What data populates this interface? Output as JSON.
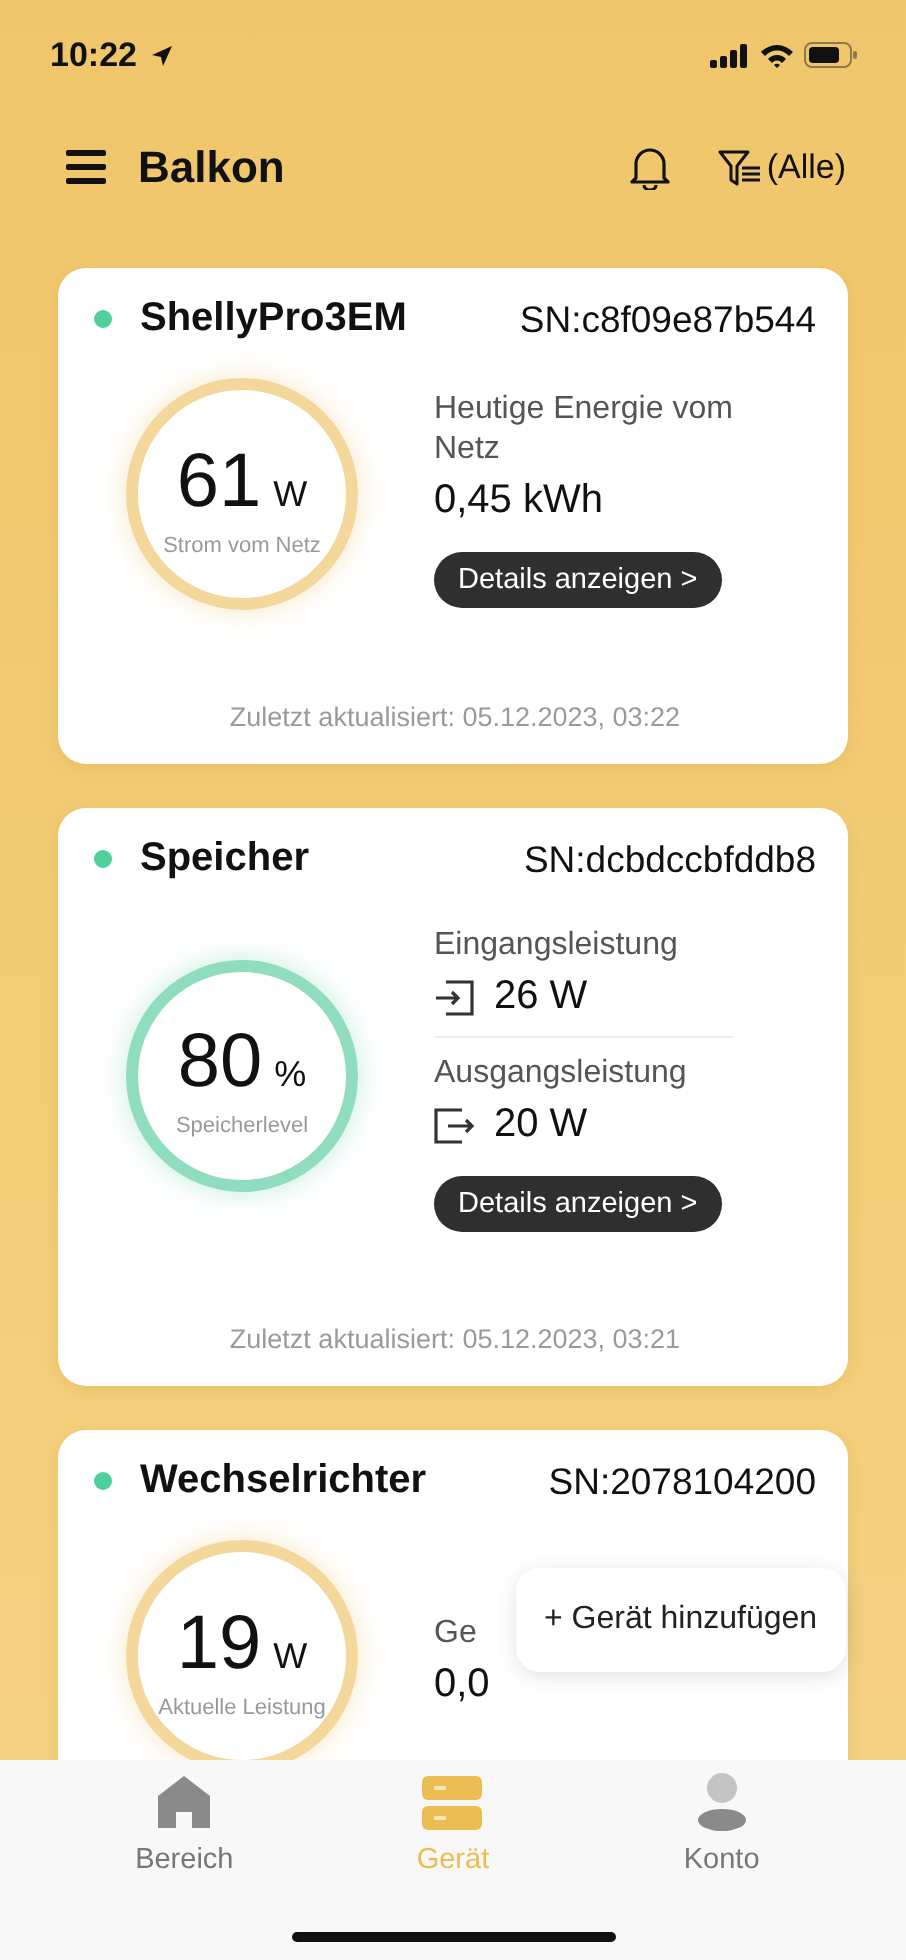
{
  "status_bar": {
    "time": "10:22"
  },
  "header": {
    "title": "Balkon",
    "filter": "(Alle)"
  },
  "cards": [
    {
      "kind": "meter",
      "name": "ShellyPro3EM",
      "online": true,
      "sn": "SN:c8f09e87b544",
      "value": "61",
      "unit": "W",
      "caption": "Strom vom Netz",
      "stats": [
        {
          "label": "Heutige Energie vom Netz",
          "value": "0,45 kWh"
        }
      ],
      "button": "Details anzeigen >",
      "updated": "Zuletzt aktualisiert: 05.12.2023, 03:22"
    },
    {
      "kind": "storage",
      "name": "Speicher",
      "online": true,
      "sn": "SN:dcbdccbfddb8",
      "value": "80",
      "unit": "%",
      "caption": "Speicherlevel",
      "stats": [
        {
          "label": "Eingangsleistung",
          "value": "26 W",
          "kind": "input"
        },
        {
          "label": "Ausgangsleistung",
          "value": "20 W",
          "kind": "output"
        }
      ],
      "button": "Details anzeigen >",
      "updated": "Zuletzt aktualisiert: 05.12.2023, 03:21"
    },
    {
      "kind": "meter",
      "name": "Wechselrichter",
      "online": true,
      "sn": "SN:2078104200",
      "value": "19",
      "unit": "W",
      "caption": "Aktuelle Leistung",
      "stats": [
        {
          "label": "Ge",
          "value": "0,0"
        }
      ]
    }
  ],
  "popup": {
    "label": "+ Gerät hinzufügen"
  },
  "tabs": [
    {
      "label": "Bereich",
      "kind": "home",
      "selected": false
    },
    {
      "label": "Gerät",
      "kind": "devices",
      "selected": true
    },
    {
      "label": "Konto",
      "kind": "account",
      "selected": false
    }
  ]
}
